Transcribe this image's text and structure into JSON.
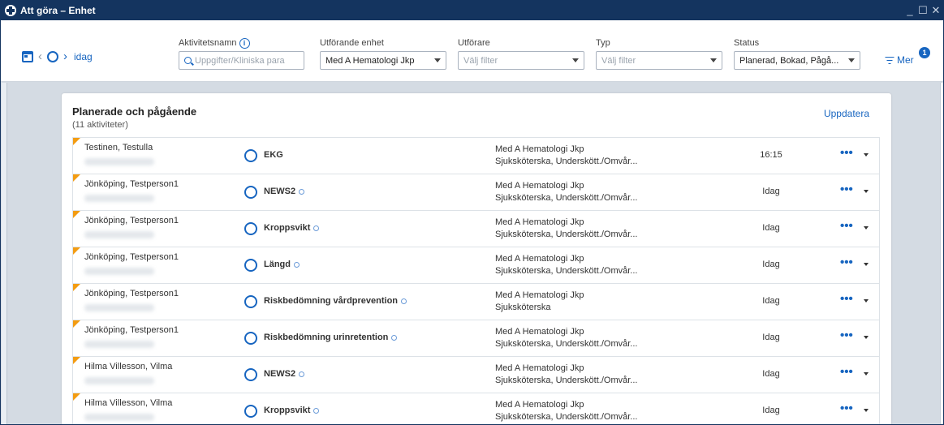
{
  "window": {
    "title": "Att göra – Enhet",
    "controls": [
      "_",
      "☐",
      "✕"
    ]
  },
  "nav": {
    "today_label": "idag"
  },
  "filters": {
    "activity": {
      "label": "Aktivitetsnamn",
      "placeholder": "Uppgifter/Kliniska para"
    },
    "unit": {
      "label": "Utförande enhet",
      "value": "Med A Hematologi Jkp"
    },
    "performer": {
      "label": "Utförare",
      "placeholder": "Välj filter"
    },
    "type": {
      "label": "Typ",
      "placeholder": "Välj filter"
    },
    "status": {
      "label": "Status",
      "value": "Planerad, Bokad, Pågå..."
    },
    "more_label": "Mer",
    "more_badge": "1"
  },
  "card": {
    "title": "Planerade och pågående",
    "subtitle": "(11 aktiviteter)",
    "refresh_label": "Uppdatera"
  },
  "rows": [
    {
      "patient": "Testinen, Testulla",
      "activity": "EKG",
      "has_info": false,
      "unit": "Med A Hematologi Jkp",
      "roles": "Sjuksköterska, Underskött./Omvår...",
      "time": "16:15"
    },
    {
      "patient": "Jönköping, Testperson1",
      "activity": "NEWS2",
      "has_info": true,
      "unit": "Med A Hematologi Jkp",
      "roles": "Sjuksköterska, Underskött./Omvår...",
      "time": "Idag"
    },
    {
      "patient": "Jönköping, Testperson1",
      "activity": "Kroppsvikt",
      "has_info": true,
      "unit": "Med A Hematologi Jkp",
      "roles": "Sjuksköterska, Underskött./Omvår...",
      "time": "Idag"
    },
    {
      "patient": "Jönköping, Testperson1",
      "activity": "Längd",
      "has_info": true,
      "unit": "Med A Hematologi Jkp",
      "roles": "Sjuksköterska, Underskött./Omvår...",
      "time": "Idag"
    },
    {
      "patient": "Jönköping, Testperson1",
      "activity": "Riskbedömning vårdprevention",
      "has_info": true,
      "unit": "Med A Hematologi Jkp",
      "roles": "Sjuksköterska",
      "time": "Idag"
    },
    {
      "patient": "Jönköping, Testperson1",
      "activity": "Riskbedömning urinretention",
      "has_info": true,
      "unit": "Med A Hematologi Jkp",
      "roles": "Sjuksköterska, Underskött./Omvår...",
      "time": "Idag"
    },
    {
      "patient": "Hilma Villesson, Vilma",
      "activity": "NEWS2",
      "has_info": true,
      "unit": "Med A Hematologi Jkp",
      "roles": "Sjuksköterska, Underskött./Omvår...",
      "time": "Idag"
    },
    {
      "patient": "Hilma Villesson, Vilma",
      "activity": "Kroppsvikt",
      "has_info": true,
      "unit": "Med A Hematologi Jkp",
      "roles": "Sjuksköterska, Underskött./Omvår...",
      "time": "Idag"
    }
  ],
  "colors": {
    "titlebar": "#14345f",
    "accent": "#1765c0",
    "flag": "#f39c12"
  }
}
